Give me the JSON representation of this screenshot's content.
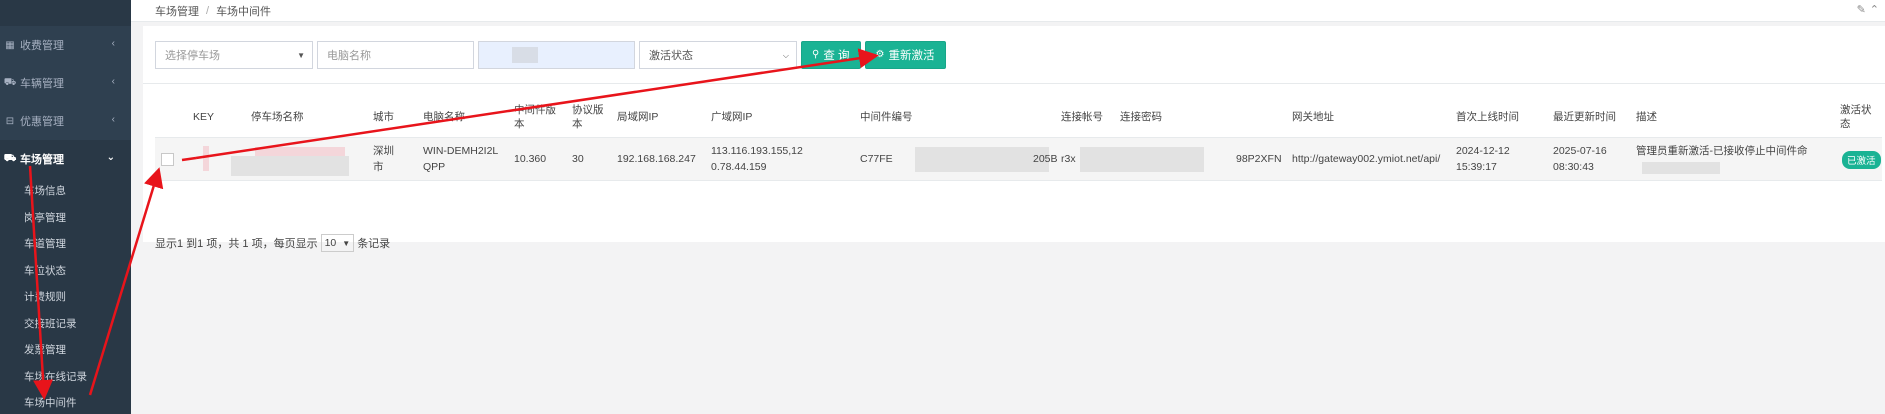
{
  "sidebar": {
    "items": [
      {
        "label": "收费管理",
        "icon": "grid-icon"
      },
      {
        "label": "车辆管理",
        "icon": "car-icon"
      },
      {
        "label": "优惠管理",
        "icon": "coupon-icon"
      },
      {
        "label": "车场管理",
        "icon": "car-icon"
      }
    ],
    "submenu": [
      "车场信息",
      "岗亭管理",
      "车道管理",
      "车位状态",
      "计费规则",
      "交接班记录",
      "发票管理",
      "车场在线记录",
      "车场中间件"
    ]
  },
  "breadcrumb": {
    "root": "车场管理",
    "separator": "/",
    "current": "车场中间件"
  },
  "filters": {
    "parking_placeholder": "选择停车场",
    "computer_placeholder": "电脑名称",
    "status_placeholder": "激活状态",
    "query_label": "查 询",
    "reactivate_label": "重新激活"
  },
  "table": {
    "headers": {
      "key": "KEY",
      "lot_name": "停车场名称",
      "city": "城市",
      "pc_name": "电脑名称",
      "mw_version": "中间件版本",
      "protocol_version": "协议版本",
      "lan_ip": "局域网IP",
      "wan_ip": "广域网IP",
      "mw_code": "中间件编号",
      "conn_account": "连接帐号",
      "conn_password": "连接密码",
      "gateway": "网关地址",
      "first_online": "首次上线时间",
      "last_update": "最近更新时间",
      "desc": "描述",
      "status": "激活状态"
    },
    "rows": [
      {
        "city": "深圳市",
        "pc_name": "WIN-DEMH2I2LQPP",
        "mw_version": "10.360",
        "protocol_version": "30",
        "lan_ip": "192.168.168.247",
        "wan_ip": "113.116.193.155,120.78.44.159",
        "mw_code_prefix": "C77FE",
        "mw_code_suffix": "205B",
        "conn_account_prefix": "r3x",
        "conn_password_suffix": "98P2XFN",
        "gateway": "http://gateway002.ymiot.net/api/",
        "first_online": "2024-12-12 15:39:17",
        "last_update": "2025-07-16 08:30:43",
        "desc": "管理员重新激活-已接收停止中间件命",
        "status": "已激活"
      }
    ]
  },
  "pagination": {
    "summary": "显示1 到1 项，共 1 项，每页显示",
    "page_size": "10",
    "suffix": "条记录"
  },
  "colors": {
    "sidebar": "#2f4050",
    "accent": "#1ab394",
    "annotation": "#e8141b"
  }
}
